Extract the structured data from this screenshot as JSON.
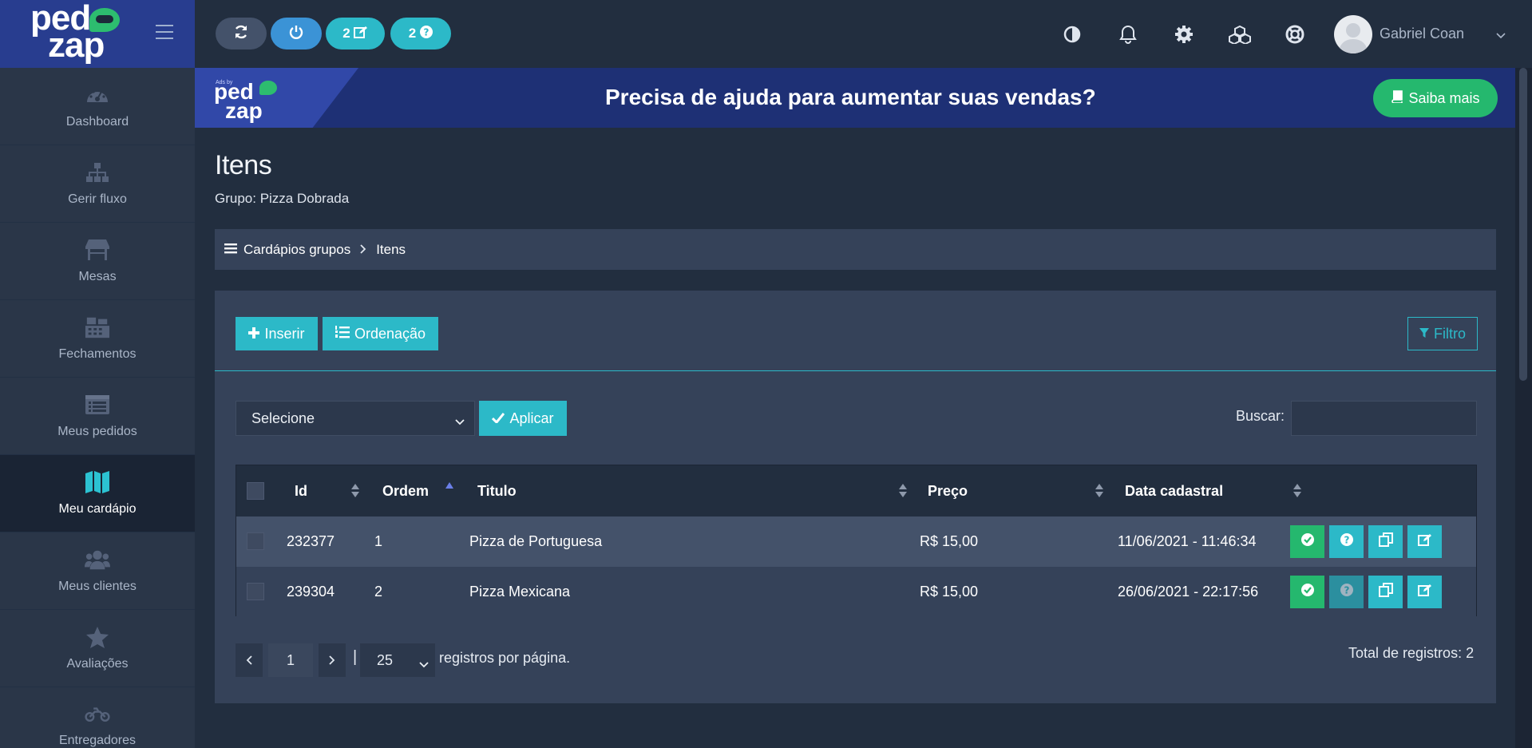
{
  "sidebar": {
    "logo": "pedzap",
    "items": [
      {
        "label": "Dashboard",
        "icon": "dashboard-icon"
      },
      {
        "label": "Gerir fluxo",
        "icon": "sitemap-icon"
      },
      {
        "label": "Mesas",
        "icon": "table-icon"
      },
      {
        "label": "Fechamentos",
        "icon": "cash-register-icon"
      },
      {
        "label": "Meus pedidos",
        "icon": "list-icon"
      },
      {
        "label": "Meu cardápio",
        "icon": "map-icon",
        "active": true
      },
      {
        "label": "Meus clientes",
        "icon": "users-icon"
      },
      {
        "label": "Avaliações",
        "icon": "star-icon"
      },
      {
        "label": "Entregadores",
        "icon": "motorcycle-icon"
      }
    ]
  },
  "topbar": {
    "pills": [
      {
        "icon": "refresh-icon",
        "count": ""
      },
      {
        "icon": "power-icon",
        "count": ""
      },
      {
        "icon": "edit-icon",
        "count": "2"
      },
      {
        "icon": "question-icon",
        "count": "2"
      }
    ],
    "icons": [
      "contrast-icon",
      "bell-icon",
      "gear-icon",
      "cubes-icon",
      "lifebuoy-icon"
    ],
    "user": {
      "name": "Gabriel Coan"
    }
  },
  "banner": {
    "ad_by": "Ads by",
    "logo": "pedzap",
    "text": "Precisa de ajuda para aumentar suas vendas?",
    "button": "Saiba mais"
  },
  "page": {
    "title": "Itens",
    "subtitle": "Grupo: Pizza Dobrada"
  },
  "breadcrumb": {
    "parent": "Cardápios grupos",
    "current": "Itens"
  },
  "toolbar": {
    "insert": "Inserir",
    "order": "Ordenação",
    "filter": "Filtro"
  },
  "bulk": {
    "select_value": "Selecione",
    "apply": "Aplicar"
  },
  "search": {
    "label": "Buscar:",
    "value": ""
  },
  "table": {
    "columns": [
      "Id",
      "Ordem",
      "Titulo",
      "Preço",
      "Data cadastral"
    ],
    "rows": [
      {
        "id": "232377",
        "ordem": "1",
        "titulo": "Pizza de Portuguesa",
        "preco": "R$ 15,00",
        "data": "11/06/2021 - 11:46:34"
      },
      {
        "id": "239304",
        "ordem": "2",
        "titulo": "Pizza Mexicana",
        "preco": "R$ 15,00",
        "data": "26/06/2021 - 22:17:56"
      }
    ]
  },
  "pagination": {
    "page": "1",
    "separator": "|",
    "per_page": "25",
    "per_page_label": "registros por página.",
    "total": "Total de registros: 2"
  },
  "colors": {
    "sidebar_bg": "#2a3648",
    "logo_bg": "#283d8f",
    "accent_cyan": "#2cb9c8",
    "accent_green": "#25b86e",
    "accent_blue": "#3b93d6",
    "page_bg": "#222e3f",
    "panel_bg": "#354259"
  }
}
